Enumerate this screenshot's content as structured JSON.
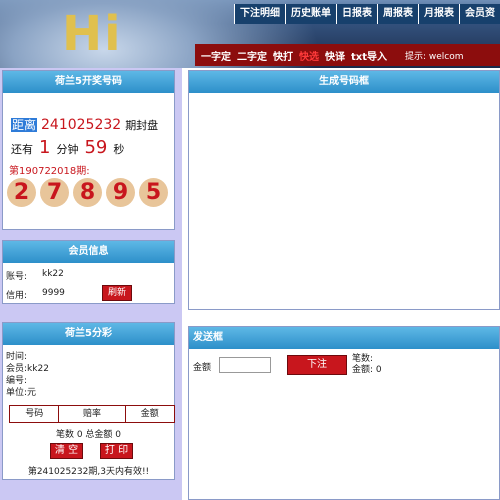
{
  "header": {
    "logo": "Hi",
    "nav": [
      "下注明细",
      "历史账单",
      "日报表",
      "周报表",
      "月报表",
      "会员资"
    ],
    "subnav": [
      "一字定",
      "二字定",
      "快打",
      "快选",
      "快译",
      "txt导入"
    ],
    "subnav_active": "快选",
    "hint": "提示: welcom"
  },
  "draw": {
    "title": "荷兰5开奖号码",
    "countdown_label": "距离",
    "issue": "241025232",
    "issue_suffix": "期封盘",
    "remain_prefix": "还有",
    "minutes": "1",
    "minutes_unit": "分钟",
    "seconds": "59",
    "seconds_unit": "秒",
    "last_issue_label": "第190722018期:",
    "numbers": [
      "2",
      "7",
      "8",
      "9",
      "5"
    ]
  },
  "member": {
    "title": "会员信息",
    "account_label": "账号:",
    "account": "kk22",
    "credit_label": "信用:",
    "credit": "9999",
    "refresh_label": "刷新"
  },
  "bet": {
    "title": "荷兰5分彩",
    "time_label": "时间:",
    "member_label": "会员:",
    "member": "kk22",
    "id_label": "编号:",
    "unit_label": "单位:",
    "unit": "元",
    "table_headers": [
      "号码",
      "赔率",
      "金额"
    ],
    "summary": "笔数 0 总金额 0",
    "clear_label": "清 空",
    "print_label": "打 印",
    "valid_note": "第241025232期,3天内有效!!"
  },
  "generator": {
    "title": "生成号码框"
  },
  "send": {
    "title": "发送框",
    "amount_label": "金额",
    "amount_value": "",
    "submit_label": "下注",
    "count_label": "笔数:",
    "total_label": "金额: 0"
  }
}
